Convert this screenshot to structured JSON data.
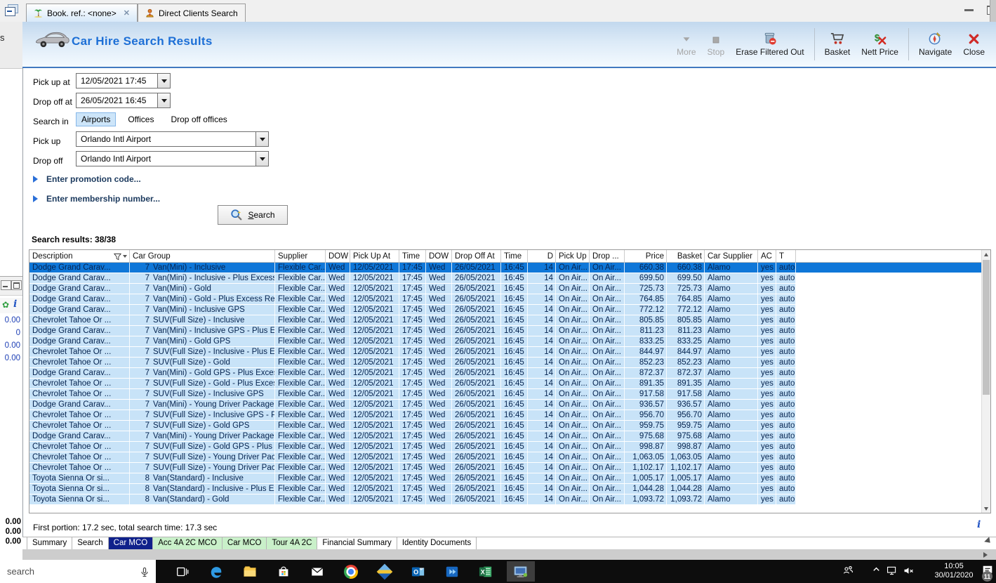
{
  "window": {
    "tabs": [
      {
        "label": "Book. ref.: <none>",
        "icon": "palm-tree",
        "closable": true,
        "active": true
      },
      {
        "label": "Direct Clients Search",
        "icon": "direct-clients",
        "closable": false,
        "active": false
      }
    ],
    "controls": [
      "minimize",
      "maximize"
    ]
  },
  "header": {
    "title": "Car Hire Search Results",
    "title_color": "#1d6fd6",
    "toolbar": [
      {
        "label": "More",
        "icon": "more-arrow",
        "disabled": true
      },
      {
        "label": "Stop",
        "icon": "stop-square",
        "disabled": true
      },
      {
        "label": "Erase Filtered Out",
        "icon": "erase-bin",
        "disabled": false
      },
      {
        "separator": true
      },
      {
        "label": "Basket",
        "icon": "basket-cart",
        "disabled": false
      },
      {
        "label": "Nett Price",
        "icon": "nett-price",
        "disabled": false
      },
      {
        "separator": true
      },
      {
        "label": "Navigate",
        "icon": "navigate-compass",
        "disabled": false
      },
      {
        "label": "Close",
        "icon": "close-x",
        "disabled": false
      }
    ]
  },
  "form": {
    "pickup_at": {
      "label": "Pick up at",
      "value": "12/05/2021 17:45"
    },
    "dropoff_at": {
      "label": "Drop off at",
      "value": "26/05/2021 16:45"
    },
    "search_in": {
      "label": "Search in",
      "options": [
        "Airports",
        "Offices",
        "Drop off offices"
      ],
      "selected": "Airports"
    },
    "pickup": {
      "label": "Pick up",
      "value": "Orlando Intl Airport"
    },
    "dropoff": {
      "label": "Drop off",
      "value": "Orlando Intl Airport"
    },
    "promo_expander": "Enter promotion code...",
    "membership_expander": "Enter membership number...",
    "search_button": "Search"
  },
  "results": {
    "count_label": "Search results: 38/38",
    "columns": [
      "Description",
      "Car Group",
      "Supplier",
      "DOW",
      "Pick Up At",
      "Time",
      "DOW",
      "Drop Off At",
      "Time",
      "D",
      "Pick Up",
      "Drop ...",
      "Price",
      "Basket",
      "Car Supplier",
      "AC",
      "T"
    ],
    "common": {
      "supplier": "Flexible Car...",
      "dow_pickup": "Wed",
      "pickup_date": "12/05/2021",
      "pickup_time": "17:45",
      "dow_dropoff": "Wed",
      "dropoff_date": "26/05/2021",
      "dropoff_time": "16:45",
      "days": "14",
      "pickup_location": "On Air...",
      "dropoff_location": "On Air...",
      "car_supplier": "Alamo",
      "ac": "yes",
      "transmission": "auto"
    },
    "rows": [
      {
        "description": "Dodge Grand Carav...",
        "group_no": "7",
        "car_group": "Van(Mini) - Inclusive",
        "price": "660.38",
        "basket": "660.38",
        "selected": true
      },
      {
        "description": "Dodge Grand Carav...",
        "group_no": "7",
        "car_group": "Van(Mini) - Inclusive - Plus Excess ...",
        "price": "699.50",
        "basket": "699.50"
      },
      {
        "description": "Dodge Grand Carav...",
        "group_no": "7",
        "car_group": "Van(Mini) - Gold",
        "price": "725.73",
        "basket": "725.73"
      },
      {
        "description": "Dodge Grand Carav...",
        "group_no": "7",
        "car_group": "Van(Mini) - Gold - Plus Excess Refu...",
        "price": "764.85",
        "basket": "764.85"
      },
      {
        "description": "Dodge Grand Carav...",
        "group_no": "7",
        "car_group": "Van(Mini) - Inclusive GPS",
        "price": "772.12",
        "basket": "772.12"
      },
      {
        "description": "Chevrolet Tahoe Or ...",
        "group_no": "7",
        "car_group": "SUV(Full Size) - Inclusive",
        "price": "805.85",
        "basket": "805.85"
      },
      {
        "description": "Dodge Grand Carav...",
        "group_no": "7",
        "car_group": "Van(Mini) - Inclusive GPS - Plus Exc...",
        "price": "811.23",
        "basket": "811.23"
      },
      {
        "description": "Dodge Grand Carav...",
        "group_no": "7",
        "car_group": "Van(Mini) - Gold GPS",
        "price": "833.25",
        "basket": "833.25"
      },
      {
        "description": "Chevrolet Tahoe Or ...",
        "group_no": "7",
        "car_group": "SUV(Full Size) - Inclusive - Plus Exc...",
        "price": "844.97",
        "basket": "844.97"
      },
      {
        "description": "Chevrolet Tahoe Or ...",
        "group_no": "7",
        "car_group": "SUV(Full Size) - Gold",
        "price": "852.23",
        "basket": "852.23"
      },
      {
        "description": "Dodge Grand Carav...",
        "group_no": "7",
        "car_group": "Van(Mini) - Gold GPS - Plus Excess ...",
        "price": "872.37",
        "basket": "872.37"
      },
      {
        "description": "Chevrolet Tahoe Or ...",
        "group_no": "7",
        "car_group": "SUV(Full Size) - Gold - Plus Excess ...",
        "price": "891.35",
        "basket": "891.35"
      },
      {
        "description": "Chevrolet Tahoe Or ...",
        "group_no": "7",
        "car_group": "SUV(Full Size) - Inclusive GPS",
        "price": "917.58",
        "basket": "917.58"
      },
      {
        "description": "Dodge Grand Carav...",
        "group_no": "7",
        "car_group": "Van(Mini) - Young Driver Package (...",
        "price": "936.57",
        "basket": "936.57"
      },
      {
        "description": "Chevrolet Tahoe Or ...",
        "group_no": "7",
        "car_group": "SUV(Full Size) - Inclusive GPS - Plus...",
        "price": "956.70",
        "basket": "956.70"
      },
      {
        "description": "Chevrolet Tahoe Or ...",
        "group_no": "7",
        "car_group": "SUV(Full Size) - Gold GPS",
        "price": "959.75",
        "basket": "959.75"
      },
      {
        "description": "Dodge Grand Carav...",
        "group_no": "7",
        "car_group": "Van(Mini) - Young Driver Package (...",
        "price": "975.68",
        "basket": "975.68"
      },
      {
        "description": "Chevrolet Tahoe Or ...",
        "group_no": "7",
        "car_group": "SUV(Full Size) - Gold GPS - Plus Exc...",
        "price": "998.87",
        "basket": "998.87"
      },
      {
        "description": "Chevrolet Tahoe Or ...",
        "group_no": "7",
        "car_group": "SUV(Full Size) - Young Driver Packa...",
        "price": "1,063.05",
        "basket": "1,063.05"
      },
      {
        "description": "Chevrolet Tahoe Or ...",
        "group_no": "7",
        "car_group": "SUV(Full Size) - Young Driver Packa...",
        "price": "1,102.17",
        "basket": "1,102.17"
      },
      {
        "description": "Toyota Sienna Or si...",
        "group_no": "8",
        "car_group": "Van(Standard) - Inclusive",
        "price": "1,005.17",
        "basket": "1,005.17"
      },
      {
        "description": "Toyota Sienna Or si...",
        "group_no": "8",
        "car_group": "Van(Standard) - Inclusive - Plus Exc...",
        "price": "1,044.28",
        "basket": "1,044.28"
      },
      {
        "description": "Toyota Sienna Or si...",
        "group_no": "8",
        "car_group": "Van(Standard) - Gold",
        "price": "1,093.72",
        "basket": "1,093.72"
      }
    ]
  },
  "status": {
    "text": "First portion: 17.2 sec, total search time: 17.3 sec",
    "info_icon": "i"
  },
  "bottom_tabs": [
    {
      "label": "Summary",
      "state": "plain"
    },
    {
      "label": "Search",
      "state": "plain"
    },
    {
      "label": "Car MCO",
      "state": "active"
    },
    {
      "label": "Acc 4A 2C MCO",
      "state": "green"
    },
    {
      "label": "Car MCO",
      "state": "green"
    },
    {
      "label": "Tour 4A 2C",
      "state": "green"
    },
    {
      "label": "Financial Summary",
      "state": "plain"
    },
    {
      "label": "Identity Documents",
      "state": "plain"
    }
  ],
  "side_panel": {
    "letter": "s",
    "icons": [
      "plant-icon",
      "info-icon"
    ],
    "plant_glyph": "✿",
    "info_glyph": "i",
    "values_top": [
      "0.00",
      "0",
      "0.00",
      "0.00"
    ],
    "values_bottom": [
      "0.00",
      "0.00",
      "0.00"
    ]
  },
  "taskbar": {
    "search_text": "search",
    "icons": [
      "task-view",
      "edge",
      "file-explorer",
      "store",
      "mail",
      "chrome",
      "travel-app",
      "outlook",
      "power-app",
      "excel",
      "active-app"
    ],
    "tray_icons": [
      "people",
      "chevron-up",
      "network",
      "volume-muted",
      "notifications"
    ],
    "clock_time": "10:05",
    "clock_date": "30/01/2020",
    "notification_badge": "11"
  },
  "colors": {
    "selected_row": "#0f77d8",
    "row_bg": "#c8e3f8",
    "active_bottom_tab": "#10218b",
    "green_tab": "#c9f0c9",
    "title_accent": "#1d6fd6",
    "header_line": "#4179c0"
  }
}
